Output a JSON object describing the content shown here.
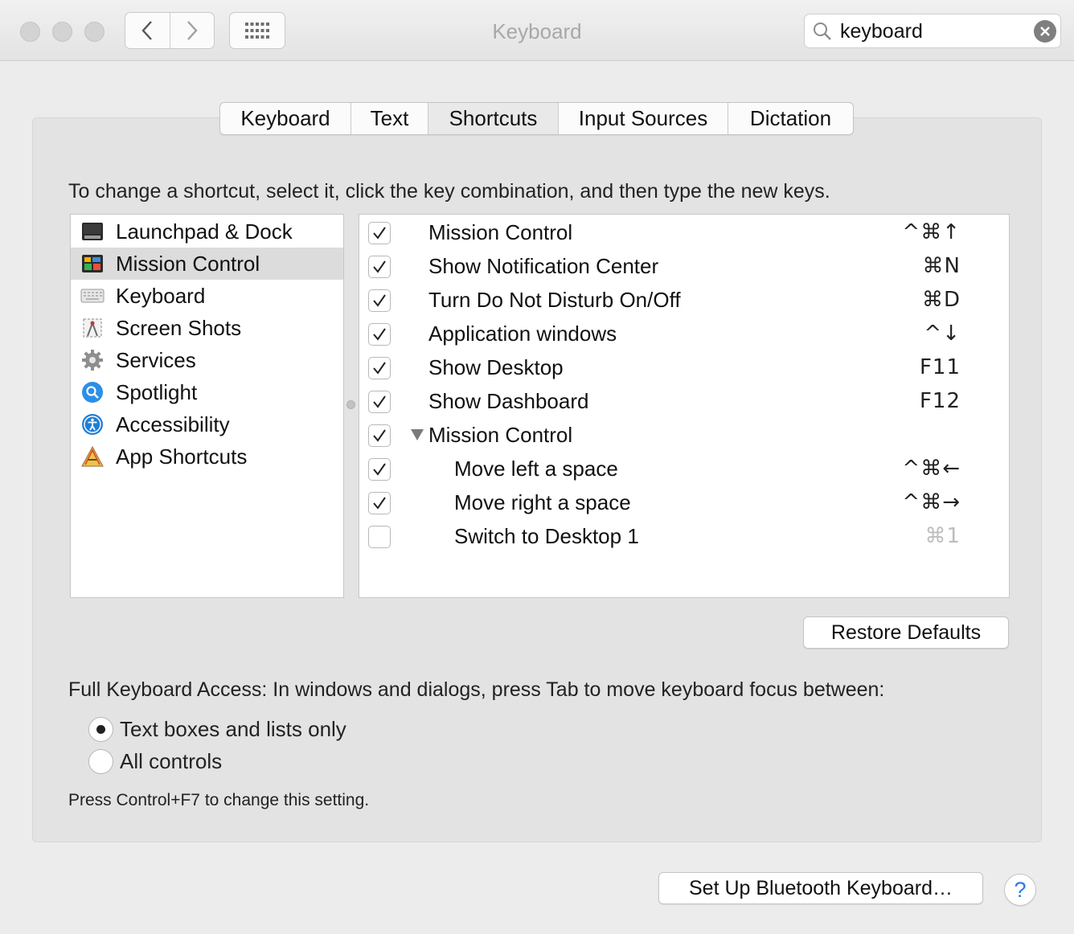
{
  "window": {
    "title": "Keyboard",
    "search": {
      "value": "keyboard",
      "placeholder": "Search"
    }
  },
  "tabs": [
    {
      "label": "Keyboard",
      "active": false
    },
    {
      "label": "Text",
      "active": false
    },
    {
      "label": "Shortcuts",
      "active": true
    },
    {
      "label": "Input Sources",
      "active": false
    },
    {
      "label": "Dictation",
      "active": false
    }
  ],
  "instructions": "To change a shortcut, select it, click the key combination, and then type the new keys.",
  "categories": [
    {
      "label": "Launchpad & Dock",
      "icon": "launchpad-dock-icon"
    },
    {
      "label": "Mission Control",
      "icon": "mission-control-icon",
      "selected": true
    },
    {
      "label": "Keyboard",
      "icon": "keyboard-icon"
    },
    {
      "label": "Screen Shots",
      "icon": "screenshot-icon"
    },
    {
      "label": "Services",
      "icon": "gear-icon"
    },
    {
      "label": "Spotlight",
      "icon": "spotlight-icon"
    },
    {
      "label": "Accessibility",
      "icon": "accessibility-icon"
    },
    {
      "label": "App Shortcuts",
      "icon": "app-shortcuts-icon"
    }
  ],
  "shortcuts": [
    {
      "label": "Mission Control",
      "keys": "^⌘↑",
      "checked": true,
      "indent": 0
    },
    {
      "label": "Show Notification Center",
      "keys": "⌘N",
      "checked": true,
      "indent": 0
    },
    {
      "label": "Turn Do Not Disturb On/Off",
      "keys": "⌘D",
      "checked": true,
      "indent": 0
    },
    {
      "label": "Application windows",
      "keys": "^↓",
      "checked": true,
      "indent": 0
    },
    {
      "label": "Show Desktop",
      "keys": "F11",
      "checked": true,
      "indent": 0
    },
    {
      "label": "Show Dashboard",
      "keys": "F12",
      "checked": true,
      "indent": 0
    },
    {
      "label": "Mission Control",
      "keys": "",
      "checked": true,
      "indent": 0,
      "group": true
    },
    {
      "label": "Move left a space",
      "keys": "^⌘←",
      "checked": true,
      "indent": 1
    },
    {
      "label": "Move right a space",
      "keys": "^⌘→",
      "checked": true,
      "indent": 1
    },
    {
      "label": "Switch to Desktop 1",
      "keys": "⌘1",
      "checked": false,
      "indent": 1,
      "dim": true
    }
  ],
  "restore_defaults": "Restore Defaults",
  "full_keyboard_access": {
    "label": "Full Keyboard Access: In windows and dialogs, press Tab to move keyboard focus between:",
    "options": [
      {
        "label": "Text boxes and lists only",
        "selected": true
      },
      {
        "label": "All controls",
        "selected": false
      }
    ],
    "hint": "Press Control+F7 to change this setting."
  },
  "bluetooth_button": "Set Up Bluetooth Keyboard…",
  "help_button": "?"
}
